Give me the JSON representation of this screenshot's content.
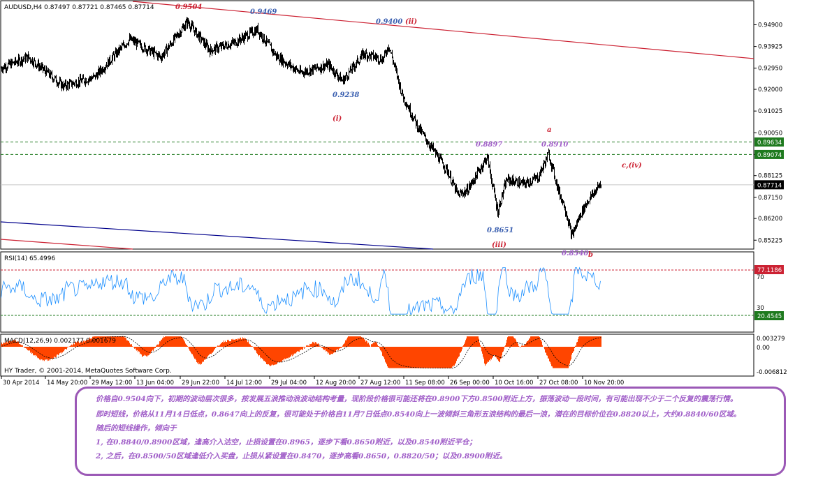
{
  "symbol_header": "AUDUSD,H4  0.87497 0.87721 0.87465 0.87714",
  "price_axis": {
    "min": 0.8492,
    "max": 0.9526,
    "ticks": [
      "0.94900",
      "0.93925",
      "0.92950",
      "0.92000",
      "0.91025",
      "0.90050",
      "0.89075",
      "0.88125",
      "0.87150",
      "0.86200",
      "0.85225"
    ],
    "tick_values": [
      0.949,
      0.93925,
      0.9295,
      0.92,
      0.91025,
      0.9005,
      0.89075,
      0.88125,
      0.8715,
      0.862,
      0.85225
    ]
  },
  "price_tags": [
    {
      "text": "0.89634",
      "value": 0.89634,
      "color": "#1e7a1e"
    },
    {
      "text": "0.89074",
      "value": 0.89074,
      "color": "#1e7a1e"
    },
    {
      "text": "0.87714",
      "value": 0.87714,
      "color": "#000000"
    }
  ],
  "wave_labels": [
    {
      "text": "0.9504",
      "value": 0.9504,
      "color": "#cc2233"
    },
    {
      "text": "0.9469",
      "value": 0.9469,
      "color": "#3a5fb0"
    },
    {
      "text": "0.9400",
      "value": 0.94,
      "color": "#3a5fb0"
    },
    {
      "text": "(ii)",
      "color": "#cc2233"
    },
    {
      "text": "0.9238",
      "value": 0.9238,
      "color": "#3a5fb0"
    },
    {
      "text": "(i)",
      "color": "#cc2233"
    },
    {
      "text": "0.8897",
      "value": 0.8897,
      "color": "#a05ec8"
    },
    {
      "text": "a",
      "color": "#cc2233"
    },
    {
      "text": "0.8910",
      "value": 0.891,
      "color": "#a05ec8"
    },
    {
      "text": "c,(iv)",
      "color": "#cc2233"
    },
    {
      "text": "0.8651",
      "value": 0.8651,
      "color": "#3a5fb0"
    },
    {
      "text": "(iii)",
      "color": "#cc2233"
    },
    {
      "text": "0.8540",
      "value": 0.854,
      "color": "#a05ec8"
    },
    {
      "text": "b",
      "color": "#cc2233"
    }
  ],
  "rsi": {
    "header": "RSI(14) 65.4996",
    "ticks": [
      "70",
      "30"
    ],
    "tags": [
      {
        "text": "77.1186",
        "color": "#cc2233"
      },
      {
        "text": "20.4545",
        "color": "#1e7a1e"
      }
    ]
  },
  "macd": {
    "header": "MACD(12,26,9) 0.002177 0.001679",
    "ticks": [
      "0.003279",
      "0.00",
      "-0.006812"
    ],
    "copyright": "HY Trader, © 2001-2014, MetaQuotes Software Corp."
  },
  "time_axis": [
    "30 Apr 2014",
    "14 May 20:00",
    "29 May 12:00",
    "13 Jun 04:00",
    "29 Jun 22:00",
    "14 Jul 12:00",
    "29 Jul 04:00",
    "12 Aug 20:00",
    "27 Aug 12:00",
    "11 Sep 08:00",
    "26 Sep 00:00",
    "10 Oct 16:00",
    "27 Oct 08:00",
    "10 Nov 20:00"
  ],
  "price_path_anchors": [
    [
      0,
      0.9295
    ],
    [
      40,
      0.9345
    ],
    [
      90,
      0.9215
    ],
    [
      135,
      0.9255
    ],
    [
      185,
      0.9425
    ],
    [
      230,
      0.9345
    ],
    [
      268,
      0.9504
    ],
    [
      300,
      0.9375
    ],
    [
      335,
      0.941
    ],
    [
      368,
      0.9469
    ],
    [
      395,
      0.935
    ],
    [
      430,
      0.9275
    ],
    [
      470,
      0.931
    ],
    [
      490,
      0.9238
    ],
    [
      520,
      0.936
    ],
    [
      548,
      0.9335
    ],
    [
      556,
      0.94
    ],
    [
      575,
      0.918
    ],
    [
      598,
      0.903
    ],
    [
      617,
      0.894
    ],
    [
      640,
      0.8835
    ],
    [
      655,
      0.8725
    ],
    [
      668,
      0.8745
    ],
    [
      676,
      0.8785
    ],
    [
      697,
      0.8897
    ],
    [
      712,
      0.8651
    ],
    [
      725,
      0.8795
    ],
    [
      750,
      0.8775
    ],
    [
      770,
      0.8805
    ],
    [
      785,
      0.891
    ],
    [
      800,
      0.8735
    ],
    [
      808,
      0.8675
    ],
    [
      818,
      0.854
    ],
    [
      830,
      0.8635
    ],
    [
      840,
      0.8695
    ],
    [
      850,
      0.8735
    ],
    [
      858,
      0.8771
    ]
  ],
  "commentary": {
    "lines": [
      "价格自0.9504向下，初期的波动层次很多，按发展五浪推动浪波动结构考量，现阶段价格很可能还将在0.8900下方0.8500附近上方，振荡波动一段时间，有可能出现不少于二个反复的震荡行情。",
      "即时短线，价格从11月14日低点，0.8647向上的反复，很可能处于价格自11月7日低点0.8540向上一波倾斜三角形五浪结构的最后一浪，潜在的目标价位在0.8820以上，大约0.8840/60区域。",
      "随后的短线操作，倾向于",
      "1, 在0.8840/0.8900区域，逢高介入沽空，止损设置在0.8965，逐步下看0.8650附近，以及0.8540附近平仓；",
      "2, 之后，在0.8500/50区域逢低介入买盘，止损从紧设置在0.8470，逐步高看0.8650，0.8820/50；以及0.8900附近。"
    ]
  },
  "colors": {
    "candles": "#000000",
    "rsi_line": "#1e90ff",
    "macd_hist": "#ff4500",
    "trend_red": "#cc2233",
    "trend_blue": "#00008b",
    "level_green": "#1e7a1e",
    "box_border": "#9b59b6",
    "comment_text": "#a05ec8"
  }
}
